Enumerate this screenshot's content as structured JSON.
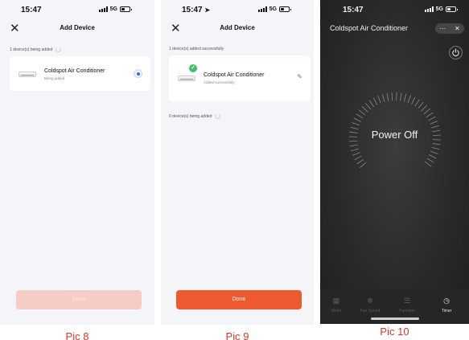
{
  "status": {
    "time": "15:47",
    "network": "5G"
  },
  "pic8": {
    "title": "Add Device",
    "section_label": "1 device(s) being added",
    "device": {
      "name": "Coldspot Air Conditioner",
      "status": "Being added"
    },
    "done_label": "Done",
    "caption": "Pic 8"
  },
  "pic9": {
    "title": "Add Device",
    "section_label": "1 device(s) added successfully",
    "device": {
      "name": "Coldspot Air Conditioner",
      "status": "Added successfully"
    },
    "pending_label": "0 device(s) being added",
    "done_label": "Done",
    "caption": "Pic 9"
  },
  "pic10": {
    "title": "Coldspot Air Conditioner",
    "state": "Power Off",
    "tabs": [
      {
        "label": "Mode",
        "icon": "mode-icon"
      },
      {
        "label": "Fan Speed",
        "icon": "fan-icon"
      },
      {
        "label": "Function",
        "icon": "menu-icon"
      },
      {
        "label": "Timer",
        "icon": "clock-icon"
      }
    ],
    "caption": "Pic 10"
  },
  "colors": {
    "accent": "#ee5a2f",
    "accent_disabled": "#f6cdc6",
    "success": "#3fbf6d",
    "caption": "#e2322b"
  }
}
